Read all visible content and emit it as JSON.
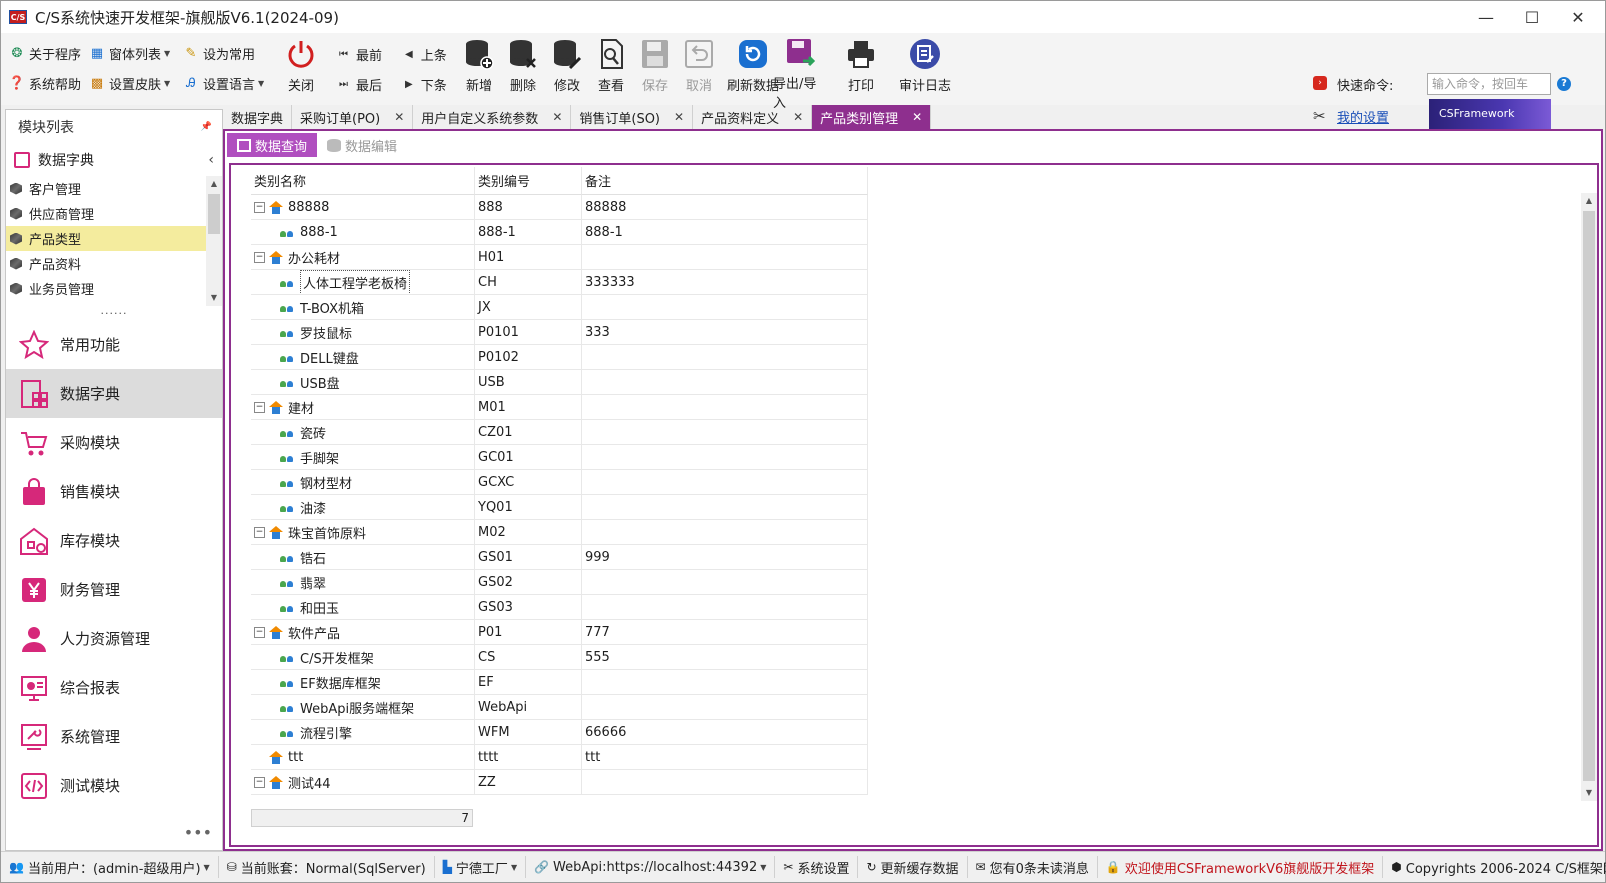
{
  "window": {
    "title": "C/S系统快速开发框架-旗舰版V6.1(2024-09)",
    "logo": "C/S"
  },
  "ribbon": {
    "about": "关于程序",
    "window_list": "窗体列表",
    "set_common": "设为常用",
    "help": "系统帮助",
    "skin": "设置皮肤",
    "language": "设置语言",
    "close": "关闭",
    "first": "最前",
    "prev": "上条",
    "last": "最后",
    "next": "下条",
    "add": "新增",
    "delete": "删除",
    "edit": "修改",
    "view": "查看",
    "save": "保存",
    "cancel": "取消",
    "refresh": "刷新数据",
    "export": "导出/导入",
    "print": "打印",
    "audit": "审计日志",
    "quick_label": "快速命令:",
    "quick_placeholder": "输入命令，按回车",
    "my_settings": "我的设置",
    "brand": "CSFramework"
  },
  "left": {
    "title": "模块列表",
    "section": "数据字典",
    "items": [
      "客户管理",
      "供应商管理",
      "产品类型",
      "产品资料",
      "业务员管理"
    ],
    "dots": "......",
    "modules": [
      "常用功能",
      "数据字典",
      "采购模块",
      "销售模块",
      "库存模块",
      "财务管理",
      "人力资源管理",
      "综合报表",
      "系统管理",
      "测试模块"
    ],
    "more": "•••"
  },
  "tabs": [
    "数据字典",
    "采购订单(PO)",
    "用户自定义系统参数",
    "销售订单(SO)",
    "产品资料定义",
    "产品类别管理"
  ],
  "tab_close": "✕",
  "subtabs": [
    "数据查询",
    "数据编辑"
  ],
  "grid": {
    "headers": [
      "类别名称",
      "类别编号",
      "备注"
    ],
    "rows": [
      {
        "name": "88888",
        "code": "888",
        "note": "88888"
      },
      {
        "name": "888-1",
        "code": "888-1",
        "note": "888-1"
      },
      {
        "name": "办公耗材",
        "code": "H01",
        "note": ""
      },
      {
        "name": "人体工程学老板椅",
        "code": "CH",
        "note": "333333"
      },
      {
        "name": "T-BOX机箱",
        "code": "JX",
        "note": ""
      },
      {
        "name": "罗技鼠标",
        "code": "P0101",
        "note": "333"
      },
      {
        "name": "DELL键盘",
        "code": "P0102",
        "note": ""
      },
      {
        "name": "USB盘",
        "code": "USB",
        "note": ""
      },
      {
        "name": "建材",
        "code": "M01",
        "note": ""
      },
      {
        "name": "瓷砖",
        "code": "CZ01",
        "note": ""
      },
      {
        "name": "手脚架",
        "code": "GC01",
        "note": ""
      },
      {
        "name": "钢材型材",
        "code": "GCXC",
        "note": ""
      },
      {
        "name": "油漆",
        "code": "YQ01",
        "note": ""
      },
      {
        "name": "珠宝首饰原料",
        "code": "M02",
        "note": ""
      },
      {
        "name": "锆石",
        "code": "GS01",
        "note": "999"
      },
      {
        "name": "翡翠",
        "code": "GS02",
        "note": ""
      },
      {
        "name": "和田玉",
        "code": "GS03",
        "note": ""
      },
      {
        "name": "软件产品",
        "code": "P01",
        "note": "777"
      },
      {
        "name": "C/S开发框架",
        "code": "CS",
        "note": "555"
      },
      {
        "name": "EF数据库框架",
        "code": "EF",
        "note": ""
      },
      {
        "name": "WebApi服务端框架",
        "code": "WebApi",
        "note": ""
      },
      {
        "name": "流程引擎",
        "code": "WFM",
        "note": "66666"
      },
      {
        "name": "ttt",
        "code": "tttt",
        "note": "ttt"
      },
      {
        "name": "测试44",
        "code": "ZZ",
        "note": ""
      }
    ],
    "scroll_value": "7"
  },
  "status": {
    "user": "当前用户：(admin-超级用户)",
    "account": "当前账套：Normal(SqlServer)",
    "factory": "宁德工厂",
    "webapi": "WebApi:https://localhost:44392",
    "settings": "系统设置",
    "cache": "更新缓存数据",
    "messages": "您有0条未读消息",
    "welcome": "欢迎使用CSFrameworkV6旗舰版开发框架",
    "copyright": "Copyrights 2006-2024 C/S框架网版权所有"
  },
  "colors": {
    "accent": "#8e2f8e",
    "subtab": "#b04fbf",
    "module_icon": "#d6287a",
    "welcome": "#c0141c",
    "link": "#1a4fb8"
  }
}
